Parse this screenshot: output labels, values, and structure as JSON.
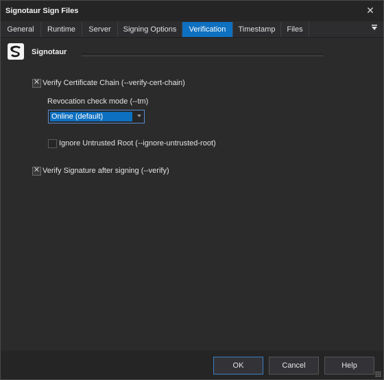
{
  "window": {
    "title": "Signotaur Sign Files",
    "close_glyph": "✕"
  },
  "tabs": [
    {
      "label": "General"
    },
    {
      "label": "Runtime"
    },
    {
      "label": "Server"
    },
    {
      "label": "Signing Options"
    },
    {
      "label": "Verification",
      "active": true
    },
    {
      "label": "Timestamp"
    },
    {
      "label": "Files"
    }
  ],
  "tab_menu_icon": "overflow-menu-icon",
  "header": {
    "brand": "Signotaur",
    "logo_icon": "signotaur-logo-icon"
  },
  "verification": {
    "verify_chain": {
      "label": "Verify Certificate Chain (--verify-cert-chain)",
      "checked": true
    },
    "revocation": {
      "label": "Revocation check mode (--tm)",
      "selected": "Online (default)"
    },
    "ignore_untrusted": {
      "label": "Ignore Untrusted Root (--ignore-untrusted-root)",
      "checked": false
    },
    "verify_signature": {
      "label": "Verify Signature after signing (--verify)",
      "checked": true
    }
  },
  "buttons": {
    "ok": "OK",
    "cancel": "Cancel",
    "help": "Help"
  },
  "colors": {
    "accent": "#0e70c0",
    "background": "#2b2b2b"
  }
}
